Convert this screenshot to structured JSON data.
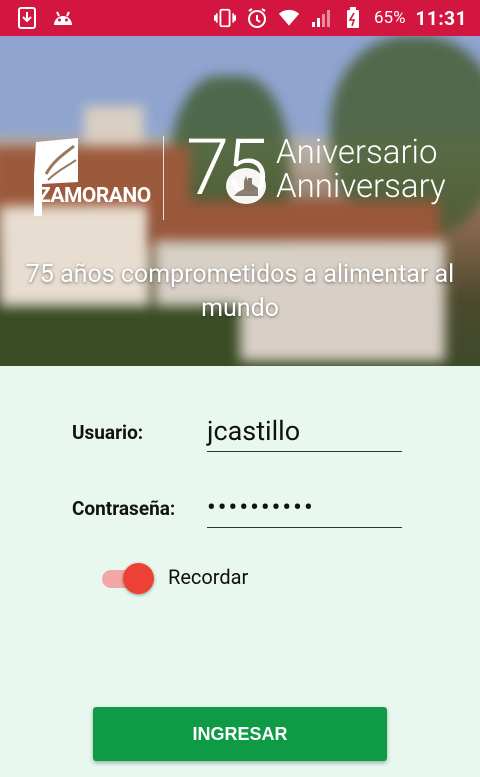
{
  "status_bar": {
    "battery_percent": "65%",
    "time": "11:31",
    "icons": [
      "download-icon",
      "android-icon",
      "vibrate-icon",
      "alarm-icon",
      "wifi-icon",
      "signal-icon",
      "battery-icon"
    ]
  },
  "header": {
    "logo_text": "ZAMORANO",
    "anniversary_number": "75",
    "anniversary_es": "Aniversario",
    "anniversary_en": "Anniversary",
    "tagline": "75 años comprometidos a alimentar al mundo"
  },
  "login": {
    "username_label": "Usuario:",
    "username_value": "jcastillo",
    "password_label": "Contraseña:",
    "password_value": "••••••••••",
    "remember_label": "Recordar",
    "remember_on": true,
    "submit_label": "INGRESAR"
  },
  "colors": {
    "status_bar": "#d3163f",
    "form_background": "#e8f8ee",
    "button": "#0e9b45",
    "toggle_thumb": "#ee4136",
    "toggle_track": "#f3a7a7"
  }
}
